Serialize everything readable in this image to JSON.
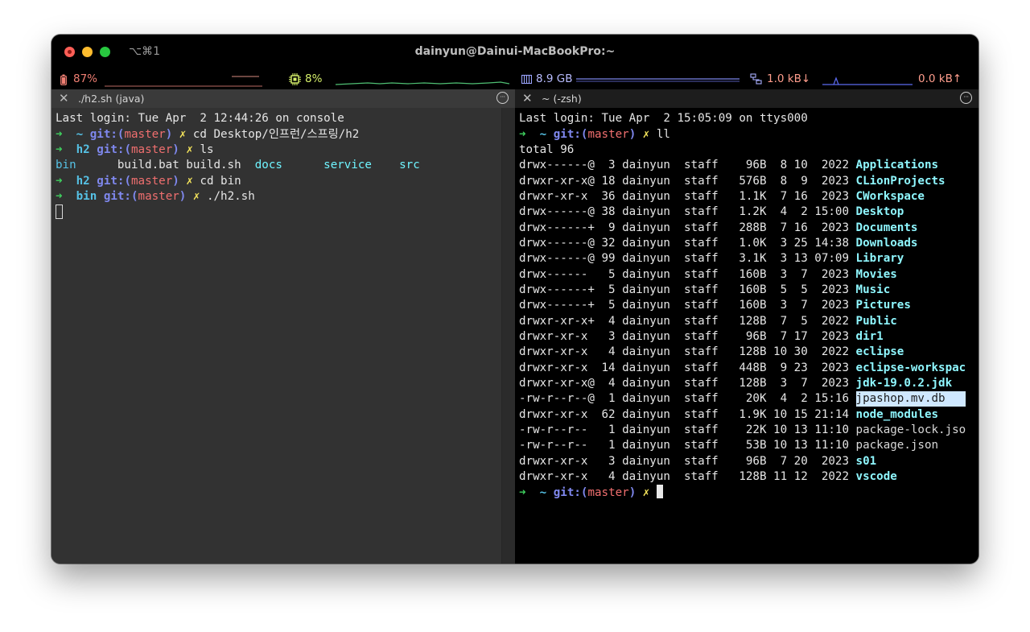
{
  "window": {
    "title": "dainyun@Dainui-MacBookPro:~",
    "shortcut": "⌥⌘1"
  },
  "status": {
    "battery": "87%",
    "cpu": "8%",
    "memory": "8.9 GB",
    "net_down": "1.0 kB↓",
    "net_up": "0.0 kB↑"
  },
  "tabs": {
    "left": {
      "title": "./h2.sh (java)"
    },
    "right": {
      "title": "~ (-zsh)"
    },
    "menu_glyph": "···",
    "close_glyph": "✕"
  },
  "left_pane": {
    "last_login": "Last login: Tue Apr  2 12:44:26 on console",
    "arrow": "➜",
    "prompts": [
      {
        "dir": "~",
        "branch": "master",
        "cmd": "cd Desktop/인프런/스프링/h2"
      },
      {
        "dir": "h2",
        "branch": "master",
        "cmd": "ls"
      },
      {
        "dir": "h2",
        "branch": "master",
        "cmd": "cd bin"
      },
      {
        "dir": "bin",
        "branch": "master",
        "cmd": "./h2.sh"
      }
    ],
    "ls_output": [
      "bin",
      "build.bat",
      "build.sh",
      "docs",
      "service",
      "src"
    ]
  },
  "right_pane": {
    "last_login": "Last login: Tue Apr  2 15:05:09 on ttys000",
    "arrow": "➜",
    "prompt": {
      "dir": "~",
      "branch": "master",
      "cmd": "ll"
    },
    "total": "total 96",
    "listing": [
      {
        "perm": "drwx------@",
        "links": "3",
        "size": "96B",
        "mon": "8",
        "day": "10",
        "time": "2022",
        "name": "Applications",
        "kind": "dir"
      },
      {
        "perm": "drwxr-xr-x@",
        "links": "18",
        "size": "576B",
        "mon": "8",
        "day": "9",
        "time": "2023",
        "name": "CLionProjects",
        "kind": "dir"
      },
      {
        "perm": "drwxr-xr-x",
        "links": "36",
        "size": "1.1K",
        "mon": "7",
        "day": "16",
        "time": "2023",
        "name": "CWorkspace",
        "kind": "dir"
      },
      {
        "perm": "drwx------@",
        "links": "38",
        "size": "1.2K",
        "mon": "4",
        "day": "2",
        "time": "15:00",
        "name": "Desktop",
        "kind": "dir"
      },
      {
        "perm": "drwx------+",
        "links": "9",
        "size": "288B",
        "mon": "7",
        "day": "16",
        "time": "2023",
        "name": "Documents",
        "kind": "dir"
      },
      {
        "perm": "drwx------@",
        "links": "32",
        "size": "1.0K",
        "mon": "3",
        "day": "25",
        "time": "14:38",
        "name": "Downloads",
        "kind": "dir"
      },
      {
        "perm": "drwx------@",
        "links": "99",
        "size": "3.1K",
        "mon": "3",
        "day": "13",
        "time": "07:09",
        "name": "Library",
        "kind": "dir"
      },
      {
        "perm": "drwx------",
        "links": "5",
        "size": "160B",
        "mon": "3",
        "day": "7",
        "time": "2023",
        "name": "Movies",
        "kind": "dir"
      },
      {
        "perm": "drwx------+",
        "links": "5",
        "size": "160B",
        "mon": "5",
        "day": "5",
        "time": "2023",
        "name": "Music",
        "kind": "dir"
      },
      {
        "perm": "drwx------+",
        "links": "5",
        "size": "160B",
        "mon": "3",
        "day": "7",
        "time": "2023",
        "name": "Pictures",
        "kind": "dir"
      },
      {
        "perm": "drwxr-xr-x+",
        "links": "4",
        "size": "128B",
        "mon": "7",
        "day": "5",
        "time": "2022",
        "name": "Public",
        "kind": "dir"
      },
      {
        "perm": "drwxr-xr-x",
        "links": "3",
        "size": "96B",
        "mon": "7",
        "day": "17",
        "time": "2023",
        "name": "dir1",
        "kind": "dir"
      },
      {
        "perm": "drwxr-xr-x",
        "links": "4",
        "size": "128B",
        "mon": "10",
        "day": "30",
        "time": "2022",
        "name": "eclipse",
        "kind": "dir"
      },
      {
        "perm": "drwxr-xr-x",
        "links": "14",
        "size": "448B",
        "mon": "9",
        "day": "23",
        "time": "2023",
        "name": "eclipse-workspace",
        "kind": "dir"
      },
      {
        "perm": "drwxr-xr-x@",
        "links": "4",
        "size": "128B",
        "mon": "3",
        "day": "7",
        "time": "2023",
        "name": "jdk-19.0.2.jdk",
        "kind": "dir"
      },
      {
        "perm": "-rw-r--r--@",
        "links": "1",
        "size": "20K",
        "mon": "4",
        "day": "2",
        "time": "15:16",
        "name": "jpashop.mv.db",
        "kind": "selected"
      },
      {
        "perm": "drwxr-xr-x",
        "links": "62",
        "size": "1.9K",
        "mon": "10",
        "day": "15",
        "time": "21:14",
        "name": "node_modules",
        "kind": "dir"
      },
      {
        "perm": "-rw-r--r--",
        "links": "1",
        "size": "22K",
        "mon": "10",
        "day": "13",
        "time": "11:10",
        "name": "package-lock.json",
        "kind": "file"
      },
      {
        "perm": "-rw-r--r--",
        "links": "1",
        "size": "53B",
        "mon": "10",
        "day": "13",
        "time": "11:10",
        "name": "package.json",
        "kind": "file"
      },
      {
        "perm": "drwxr-xr-x",
        "links": "3",
        "size": "96B",
        "mon": "7",
        "day": "20",
        "time": "2023",
        "name": "s01",
        "kind": "dir"
      },
      {
        "perm": "drwxr-xr-x",
        "links": "4",
        "size": "128B",
        "mon": "11",
        "day": "12",
        "time": "2022",
        "name": "vscode",
        "kind": "dir"
      }
    ],
    "owner": "dainyun",
    "group": "staff",
    "final_prompt": {
      "dir": "~",
      "branch": "master"
    }
  },
  "colors": {
    "prompt_arrow": "#3fd15f",
    "git_label": "#7f88ee",
    "branch": "#f06f6f",
    "dirty_mark": "#f3e35b",
    "directory": "#8ff7ff",
    "selection": "#cfe8ff"
  }
}
